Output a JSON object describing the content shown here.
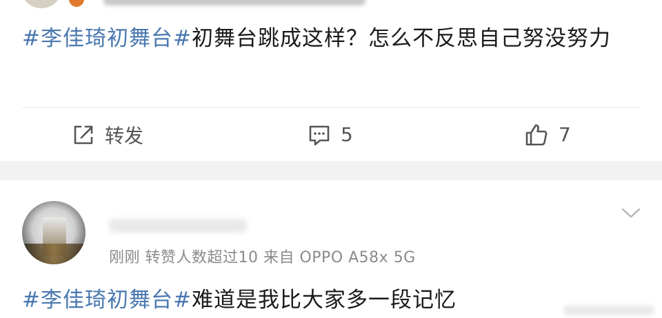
{
  "post": {
    "tag": "#李佳琦初舞台#",
    "text": "初舞台跳成这样？怎么不反思自己努没努力"
  },
  "actions": {
    "share_label": "转发",
    "comment_count": "5",
    "like_count": "7"
  },
  "comment": {
    "meta": "刚刚 转赞人数超过10  来自 OPPO A58x 5G",
    "tag": "#李佳琦初舞台#",
    "text": "难道是我比大家多一段记忆"
  },
  "icons": {
    "share": "share-icon",
    "comment": "comment-icon",
    "like": "thumbs-up-icon",
    "more": "chevron-down-icon"
  }
}
